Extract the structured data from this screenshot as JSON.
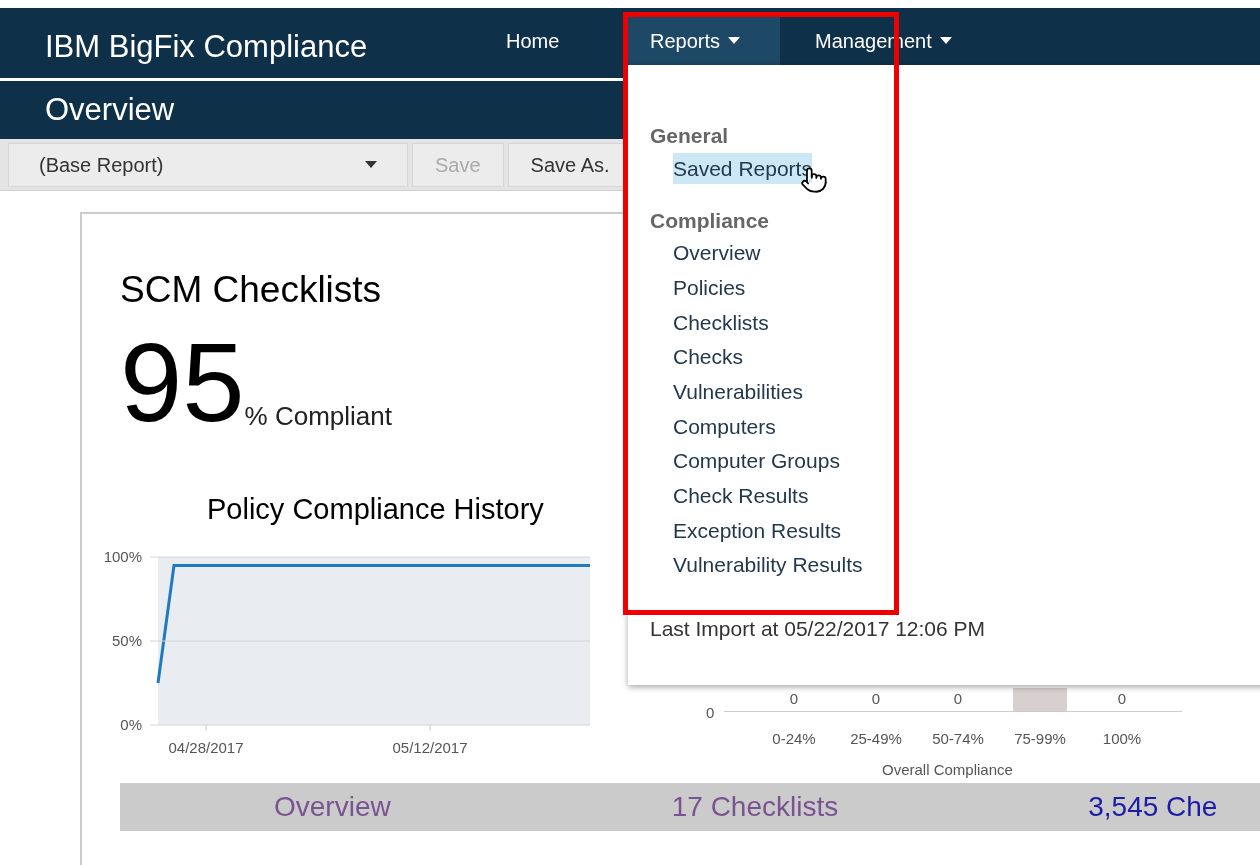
{
  "app_title": "IBM BigFix Compliance",
  "nav": [
    {
      "label": "Home",
      "dropdown": false,
      "selected": false
    },
    {
      "label": "Reports",
      "dropdown": true,
      "selected": true
    },
    {
      "label": "Management",
      "dropdown": true,
      "selected": false
    }
  ],
  "page_title": "Overview",
  "toolbar": {
    "report_select": "(Base Report)",
    "buttons": [
      {
        "label": "Save",
        "disabled": true
      },
      {
        "label": "Save As.",
        "disabled": false
      }
    ]
  },
  "card": {
    "title": "SCM Checklists",
    "percent": "95",
    "percent_suffix": "% Compliant",
    "history": {
      "title": "Policy Compliance History",
      "chart_data": {
        "type": "line",
        "categories": [
          null,
          null,
          null,
          "04/28/2017",
          null,
          null,
          null,
          null,
          null,
          null,
          null,
          null,
          null,
          null,
          null,
          null,
          null,
          "05/12/2017",
          null,
          null,
          null,
          null,
          null,
          null,
          null,
          null,
          null,
          null
        ],
        "values": [
          25,
          95,
          95,
          95,
          95,
          95,
          95,
          95,
          95,
          95,
          95,
          95,
          95,
          95,
          95,
          95,
          95,
          95,
          95,
          95,
          95,
          95,
          95,
          95,
          95,
          95,
          95,
          95
        ],
        "ylim": [
          0,
          100
        ],
        "yticks": [
          {
            "value": 0,
            "label": "0%"
          },
          {
            "value": 50,
            "label": "50%"
          },
          {
            "value": 100,
            "label": "100%"
          }
        ]
      }
    },
    "distribution": {
      "y_tick": "0",
      "xlabel": "Overall Compliance",
      "bins": [
        {
          "label": "0-24%",
          "count": "0",
          "bar": false
        },
        {
          "label": "25-49%",
          "count": "0",
          "bar": false
        },
        {
          "label": "50-74%",
          "count": "0",
          "bar": false
        },
        {
          "label": "75-99%",
          "bar": true
        },
        {
          "label": "100%",
          "count": "0",
          "bar": false
        }
      ]
    },
    "summary": [
      {
        "label": "Overview",
        "color": "#7a5391"
      },
      {
        "label": "17 Checklists",
        "color": "#7a5391"
      },
      {
        "label": "3,545 Che",
        "color": "#1c1ca8"
      }
    ]
  },
  "menu": {
    "groups": [
      {
        "heading": "General",
        "items": [
          {
            "label": "Saved Reports",
            "selected": true
          }
        ]
      },
      {
        "heading": "Compliance",
        "items": [
          {
            "label": "Overview",
            "selected": false
          },
          {
            "label": "Policies",
            "selected": false
          },
          {
            "label": "Checklists",
            "selected": false
          },
          {
            "label": "Checks",
            "selected": false
          },
          {
            "label": "Vulnerabilities",
            "selected": false
          },
          {
            "label": "Computers",
            "selected": false
          },
          {
            "label": "Computer Groups",
            "selected": false
          },
          {
            "label": "Check Results",
            "selected": false
          },
          {
            "label": "Exception Results",
            "selected": false
          },
          {
            "label": "Vulnerability Results",
            "selected": false
          }
        ]
      }
    ],
    "footer": "Last Import at 05/22/2017 12:06 PM"
  }
}
